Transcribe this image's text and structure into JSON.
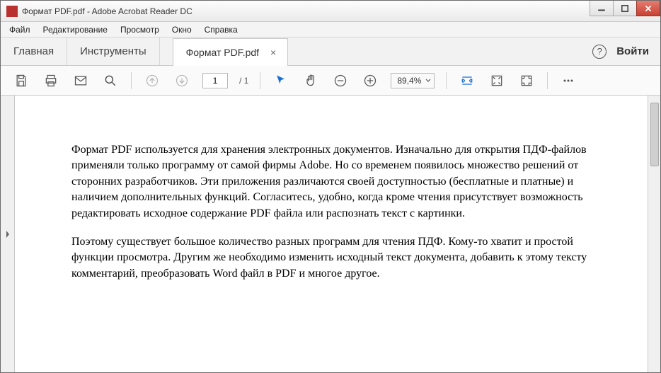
{
  "window": {
    "title": "Формат PDF.pdf - Adobe Acrobat Reader DC"
  },
  "menu": {
    "file": "Файл",
    "edit": "Редактирование",
    "view": "Просмотр",
    "window": "Окно",
    "help": "Справка"
  },
  "tabs": {
    "home": "Главная",
    "tools": "Инструменты",
    "doc": "Формат PDF.pdf",
    "help_glyph": "?",
    "signin": "Войти"
  },
  "toolbar": {
    "page_current": "1",
    "page_total": "/ 1",
    "zoom": "89,4%"
  },
  "document": {
    "para1": "Формат PDF используется для хранения электронных документов. Изначально для открытия ПДФ-файлов применяли только программу от самой фирмы Adobe. Но со временем появилось множество решений от сторонних разработчиков. Эти приложения различаются своей доступностью (бесплатные и платные) и наличием дополнительных функций. Согласитесь, удобно, когда кроме чтения присутствует возможность редактировать исходное содержание PDF файла или распознать текст с картинки.",
    "para2": "Поэтому существует большое количество разных программ для чтения ПДФ. Кому-то хватит и простой функции просмотра. Другим же необходимо изменить исходный текст документа, добавить к этому тексту комментарий, преобразовать Word файл в PDF и многое другое."
  }
}
